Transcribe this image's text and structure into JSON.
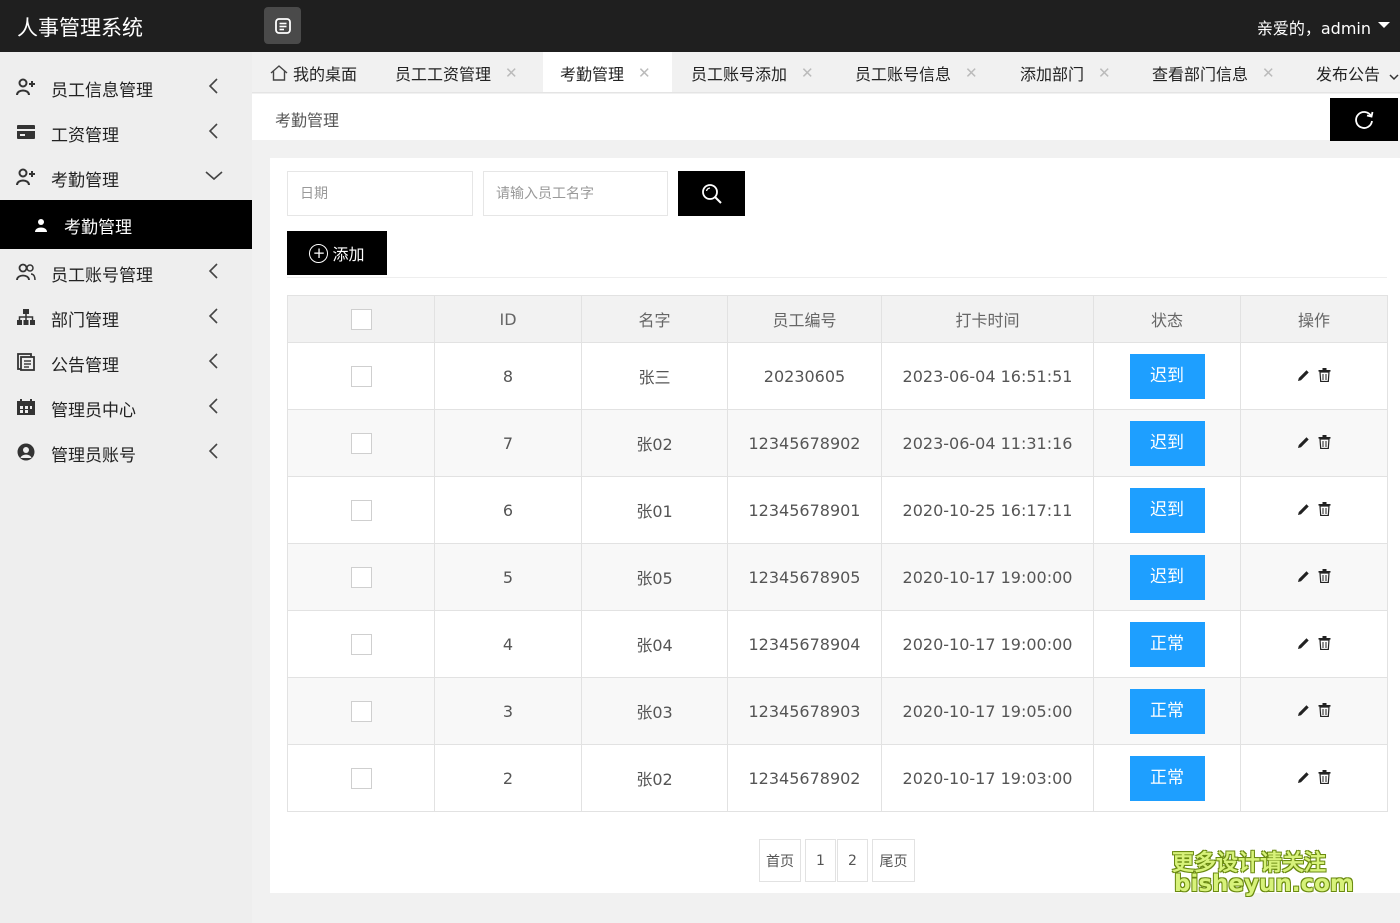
{
  "header": {
    "app_title": "人事管理系统",
    "user_label": "亲爱的，admin"
  },
  "sidebar": {
    "items": [
      {
        "label": "员工信息管理",
        "icon": "user-plus-icon"
      },
      {
        "label": "工资管理",
        "icon": "wallet-icon"
      },
      {
        "label": "考勤管理",
        "icon": "user-plus-icon",
        "expanded": true
      },
      {
        "label": "员工账号管理",
        "icon": "users-icon"
      },
      {
        "label": "部门管理",
        "icon": "sitemap-icon"
      },
      {
        "label": "公告管理",
        "icon": "document-icon"
      },
      {
        "label": "管理员中心",
        "icon": "calendar-icon"
      },
      {
        "label": "管理员账号",
        "icon": "user-circle-icon"
      }
    ],
    "sub_item": {
      "label": "考勤管理",
      "icon": "user-small-icon"
    }
  },
  "tabs": [
    {
      "label": "我的桌面",
      "closable": false,
      "icon": "home-icon"
    },
    {
      "label": "员工工资管理",
      "closable": true
    },
    {
      "label": "考勤管理",
      "closable": true,
      "active": true
    },
    {
      "label": "员工账号添加",
      "closable": true
    },
    {
      "label": "员工账号信息",
      "closable": true
    },
    {
      "label": "添加部门",
      "closable": true
    },
    {
      "label": "查看部门信息",
      "closable": true
    },
    {
      "label": "发布公告",
      "closable": false
    }
  ],
  "close_glyph": "✕",
  "breadcrumb": "考勤管理",
  "search": {
    "date_placeholder": "日期",
    "name_placeholder": "请输入员工名字"
  },
  "add_label": "添加",
  "add_plus": "+",
  "table": {
    "headers": [
      "ID",
      "名字",
      "员工编号",
      "打卡时间",
      "状态",
      "操作"
    ],
    "rows": [
      {
        "id": "8",
        "name": "张三",
        "emp_no": "20230605",
        "time": "2023-06-04 16:51:51",
        "status": "迟到"
      },
      {
        "id": "7",
        "name": "张02",
        "emp_no": "12345678902",
        "time": "2023-06-04 11:31:16",
        "status": "迟到"
      },
      {
        "id": "6",
        "name": "张01",
        "emp_no": "12345678901",
        "time": "2020-10-25 16:17:11",
        "status": "迟到"
      },
      {
        "id": "5",
        "name": "张05",
        "emp_no": "12345678905",
        "time": "2020-10-17 19:00:00",
        "status": "迟到"
      },
      {
        "id": "4",
        "name": "张04",
        "emp_no": "12345678904",
        "time": "2020-10-17 19:00:00",
        "status": "正常"
      },
      {
        "id": "3",
        "name": "张03",
        "emp_no": "12345678903",
        "time": "2020-10-17 19:05:00",
        "status": "正常"
      },
      {
        "id": "2",
        "name": "张02",
        "emp_no": "12345678902",
        "time": "2020-10-17 19:03:00",
        "status": "正常"
      }
    ]
  },
  "pager": {
    "first": "首页",
    "pages": [
      "1",
      "2"
    ],
    "last": "尾页"
  },
  "watermark": {
    "line1": "更多设计请关注",
    "line2": "bisheyun.com"
  },
  "colors": {
    "header_bg": "#1f1f1f",
    "status_blue": "#1e9fff",
    "sidebar_bg": "#eeeeee",
    "active_item": "#000000"
  }
}
